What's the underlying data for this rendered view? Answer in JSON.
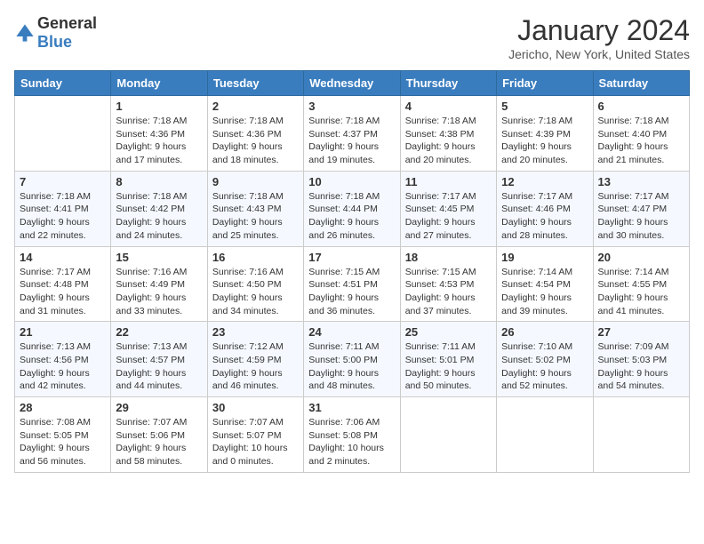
{
  "logo": {
    "general": "General",
    "blue": "Blue"
  },
  "title": "January 2024",
  "location": "Jericho, New York, United States",
  "days_of_week": [
    "Sunday",
    "Monday",
    "Tuesday",
    "Wednesday",
    "Thursday",
    "Friday",
    "Saturday"
  ],
  "weeks": [
    [
      {
        "day": "",
        "info": ""
      },
      {
        "day": "1",
        "info": "Sunrise: 7:18 AM\nSunset: 4:36 PM\nDaylight: 9 hours\nand 17 minutes."
      },
      {
        "day": "2",
        "info": "Sunrise: 7:18 AM\nSunset: 4:36 PM\nDaylight: 9 hours\nand 18 minutes."
      },
      {
        "day": "3",
        "info": "Sunrise: 7:18 AM\nSunset: 4:37 PM\nDaylight: 9 hours\nand 19 minutes."
      },
      {
        "day": "4",
        "info": "Sunrise: 7:18 AM\nSunset: 4:38 PM\nDaylight: 9 hours\nand 20 minutes."
      },
      {
        "day": "5",
        "info": "Sunrise: 7:18 AM\nSunset: 4:39 PM\nDaylight: 9 hours\nand 20 minutes."
      },
      {
        "day": "6",
        "info": "Sunrise: 7:18 AM\nSunset: 4:40 PM\nDaylight: 9 hours\nand 21 minutes."
      }
    ],
    [
      {
        "day": "7",
        "info": "Sunrise: 7:18 AM\nSunset: 4:41 PM\nDaylight: 9 hours\nand 22 minutes."
      },
      {
        "day": "8",
        "info": "Sunrise: 7:18 AM\nSunset: 4:42 PM\nDaylight: 9 hours\nand 24 minutes."
      },
      {
        "day": "9",
        "info": "Sunrise: 7:18 AM\nSunset: 4:43 PM\nDaylight: 9 hours\nand 25 minutes."
      },
      {
        "day": "10",
        "info": "Sunrise: 7:18 AM\nSunset: 4:44 PM\nDaylight: 9 hours\nand 26 minutes."
      },
      {
        "day": "11",
        "info": "Sunrise: 7:17 AM\nSunset: 4:45 PM\nDaylight: 9 hours\nand 27 minutes."
      },
      {
        "day": "12",
        "info": "Sunrise: 7:17 AM\nSunset: 4:46 PM\nDaylight: 9 hours\nand 28 minutes."
      },
      {
        "day": "13",
        "info": "Sunrise: 7:17 AM\nSunset: 4:47 PM\nDaylight: 9 hours\nand 30 minutes."
      }
    ],
    [
      {
        "day": "14",
        "info": "Sunrise: 7:17 AM\nSunset: 4:48 PM\nDaylight: 9 hours\nand 31 minutes."
      },
      {
        "day": "15",
        "info": "Sunrise: 7:16 AM\nSunset: 4:49 PM\nDaylight: 9 hours\nand 33 minutes."
      },
      {
        "day": "16",
        "info": "Sunrise: 7:16 AM\nSunset: 4:50 PM\nDaylight: 9 hours\nand 34 minutes."
      },
      {
        "day": "17",
        "info": "Sunrise: 7:15 AM\nSunset: 4:51 PM\nDaylight: 9 hours\nand 36 minutes."
      },
      {
        "day": "18",
        "info": "Sunrise: 7:15 AM\nSunset: 4:53 PM\nDaylight: 9 hours\nand 37 minutes."
      },
      {
        "day": "19",
        "info": "Sunrise: 7:14 AM\nSunset: 4:54 PM\nDaylight: 9 hours\nand 39 minutes."
      },
      {
        "day": "20",
        "info": "Sunrise: 7:14 AM\nSunset: 4:55 PM\nDaylight: 9 hours\nand 41 minutes."
      }
    ],
    [
      {
        "day": "21",
        "info": "Sunrise: 7:13 AM\nSunset: 4:56 PM\nDaylight: 9 hours\nand 42 minutes."
      },
      {
        "day": "22",
        "info": "Sunrise: 7:13 AM\nSunset: 4:57 PM\nDaylight: 9 hours\nand 44 minutes."
      },
      {
        "day": "23",
        "info": "Sunrise: 7:12 AM\nSunset: 4:59 PM\nDaylight: 9 hours\nand 46 minutes."
      },
      {
        "day": "24",
        "info": "Sunrise: 7:11 AM\nSunset: 5:00 PM\nDaylight: 9 hours\nand 48 minutes."
      },
      {
        "day": "25",
        "info": "Sunrise: 7:11 AM\nSunset: 5:01 PM\nDaylight: 9 hours\nand 50 minutes."
      },
      {
        "day": "26",
        "info": "Sunrise: 7:10 AM\nSunset: 5:02 PM\nDaylight: 9 hours\nand 52 minutes."
      },
      {
        "day": "27",
        "info": "Sunrise: 7:09 AM\nSunset: 5:03 PM\nDaylight: 9 hours\nand 54 minutes."
      }
    ],
    [
      {
        "day": "28",
        "info": "Sunrise: 7:08 AM\nSunset: 5:05 PM\nDaylight: 9 hours\nand 56 minutes."
      },
      {
        "day": "29",
        "info": "Sunrise: 7:07 AM\nSunset: 5:06 PM\nDaylight: 9 hours\nand 58 minutes."
      },
      {
        "day": "30",
        "info": "Sunrise: 7:07 AM\nSunset: 5:07 PM\nDaylight: 10 hours\nand 0 minutes."
      },
      {
        "day": "31",
        "info": "Sunrise: 7:06 AM\nSunset: 5:08 PM\nDaylight: 10 hours\nand 2 minutes."
      },
      {
        "day": "",
        "info": ""
      },
      {
        "day": "",
        "info": ""
      },
      {
        "day": "",
        "info": ""
      }
    ]
  ]
}
